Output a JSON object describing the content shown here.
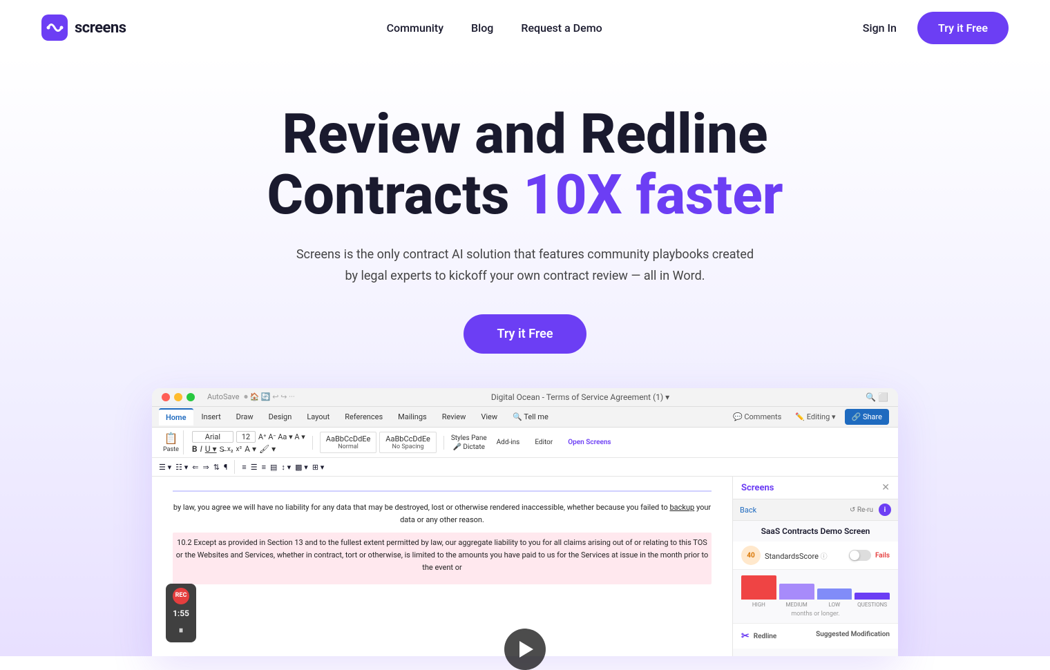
{
  "brand": {
    "name": "screens",
    "logo_color": "#6c3ef4"
  },
  "nav": {
    "links": [
      {
        "label": "Community",
        "href": "#"
      },
      {
        "label": "Blog",
        "href": "#"
      },
      {
        "label": "Request a Demo",
        "href": "#"
      },
      {
        "label": "Sign In",
        "href": "#"
      }
    ],
    "cta_label": "Try it Free"
  },
  "hero": {
    "title_line1": "Review and Redline",
    "title_line2_normal": "Contracts ",
    "title_line2_accent": "10X faster",
    "subtitle": "Screens is the only contract AI solution that features community playbooks created by legal experts to kickoff your own contract review — all in Word.",
    "cta_label": "Try it Free"
  },
  "word_mockup": {
    "title_bar_text": "Digital Ocean - Terms of Service Agreement (1) ▾",
    "autosave_text": "AutoSave",
    "ribbon_tabs": [
      "Home",
      "Insert",
      "Draw",
      "Design",
      "Layout",
      "References",
      "Mailings",
      "Review",
      "View",
      "Tell me"
    ],
    "active_tab": "Home",
    "toolbar_font": "Arial",
    "toolbar_size": "12",
    "doc_paragraph1": "by law, you agree we will have no liability for any data that may be destroyed, lost or otherwise rendered inaccessible, whether because you failed to backup your data or any other reason.",
    "doc_paragraph2": "10.2 Except as provided in Section 13 and to the fullest extent permitted by law, our aggregate liability to you for all claims arising out of or relating to this TOS or the Websites and Services, whether in contract, tort or otherwise, is limited to the amounts you have paid to us for the Services at issue in the month prior to the event or",
    "screens_panel": {
      "title": "Screens",
      "back_label": "Back",
      "rerun_label": "Re-ru",
      "section_title": "SaaS Contracts Demo Screen",
      "score_number": "40",
      "score_label": "StandardsScore",
      "toggle_label": "Fails",
      "chart_bars": [
        {
          "label": "HIGH",
          "height": 30,
          "color": "#ef4444"
        },
        {
          "label": "MEDIUM",
          "height": 20,
          "color": "#a78bfa"
        },
        {
          "label": "LOW",
          "height": 15,
          "color": "#818cf8"
        },
        {
          "label": "QUESTIONS",
          "height": 10,
          "color": "#6c3ef4"
        }
      ],
      "note_text": "months or longer.",
      "redline_label": "Redline",
      "suggested_label": "Suggested Modification"
    },
    "timer": {
      "rec_label": "REC",
      "time_label": "1:55",
      "pause_icon": "⏸"
    }
  },
  "styles_panel": {
    "style1": "AaBbCcDdEe",
    "style1_label": "Normal",
    "style2": "AaBbCcDdEe",
    "style2_label": "No Spacing"
  }
}
